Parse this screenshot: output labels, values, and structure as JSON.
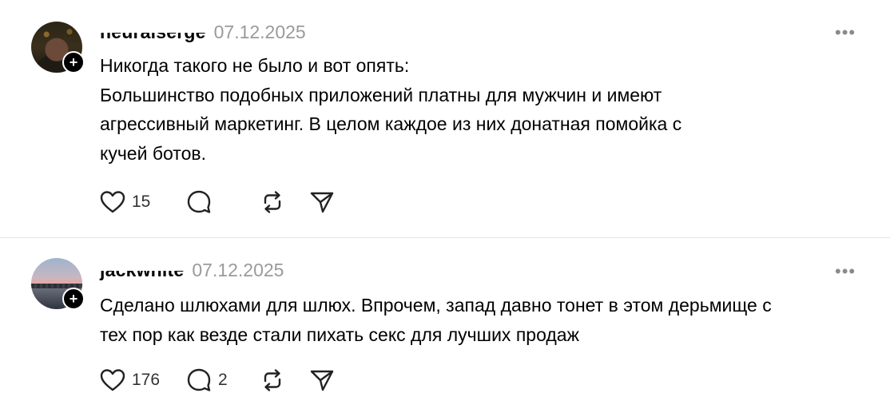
{
  "posts": [
    {
      "username": "neuralserge",
      "date": "07.12.2025",
      "more_label": "•••",
      "text_lines": [
        "Никогда такого не было и вот опять:",
        "Большинство подобных приложений платны для мужчин и имеют",
        "агрессивный маркетинг. В целом каждое из них донатная помойка с",
        "кучей ботов."
      ],
      "likes": "15",
      "comments": "",
      "icons": {
        "like": "heart-icon",
        "comment": "comment-bubble-icon",
        "repost": "repost-icon",
        "share": "send-icon"
      }
    },
    {
      "username": "jackwhite",
      "date": "07.12.2025",
      "more_label": "•••",
      "text_lines": [
        "Сделано шлюхами для шлюх. Впрочем, запад давно тонет в этом дерьмище с",
        "тех пор как везде стали пихать секс для лучших продаж"
      ],
      "likes": "176",
      "comments": "2",
      "icons": {
        "like": "heart-icon",
        "comment": "comment-bubble-icon",
        "repost": "repost-icon",
        "share": "send-icon"
      }
    }
  ],
  "follow_badge": "+",
  "colors": {
    "text": "#000000",
    "muted": "#9a9a9a",
    "divider": "#e3e3e3"
  }
}
